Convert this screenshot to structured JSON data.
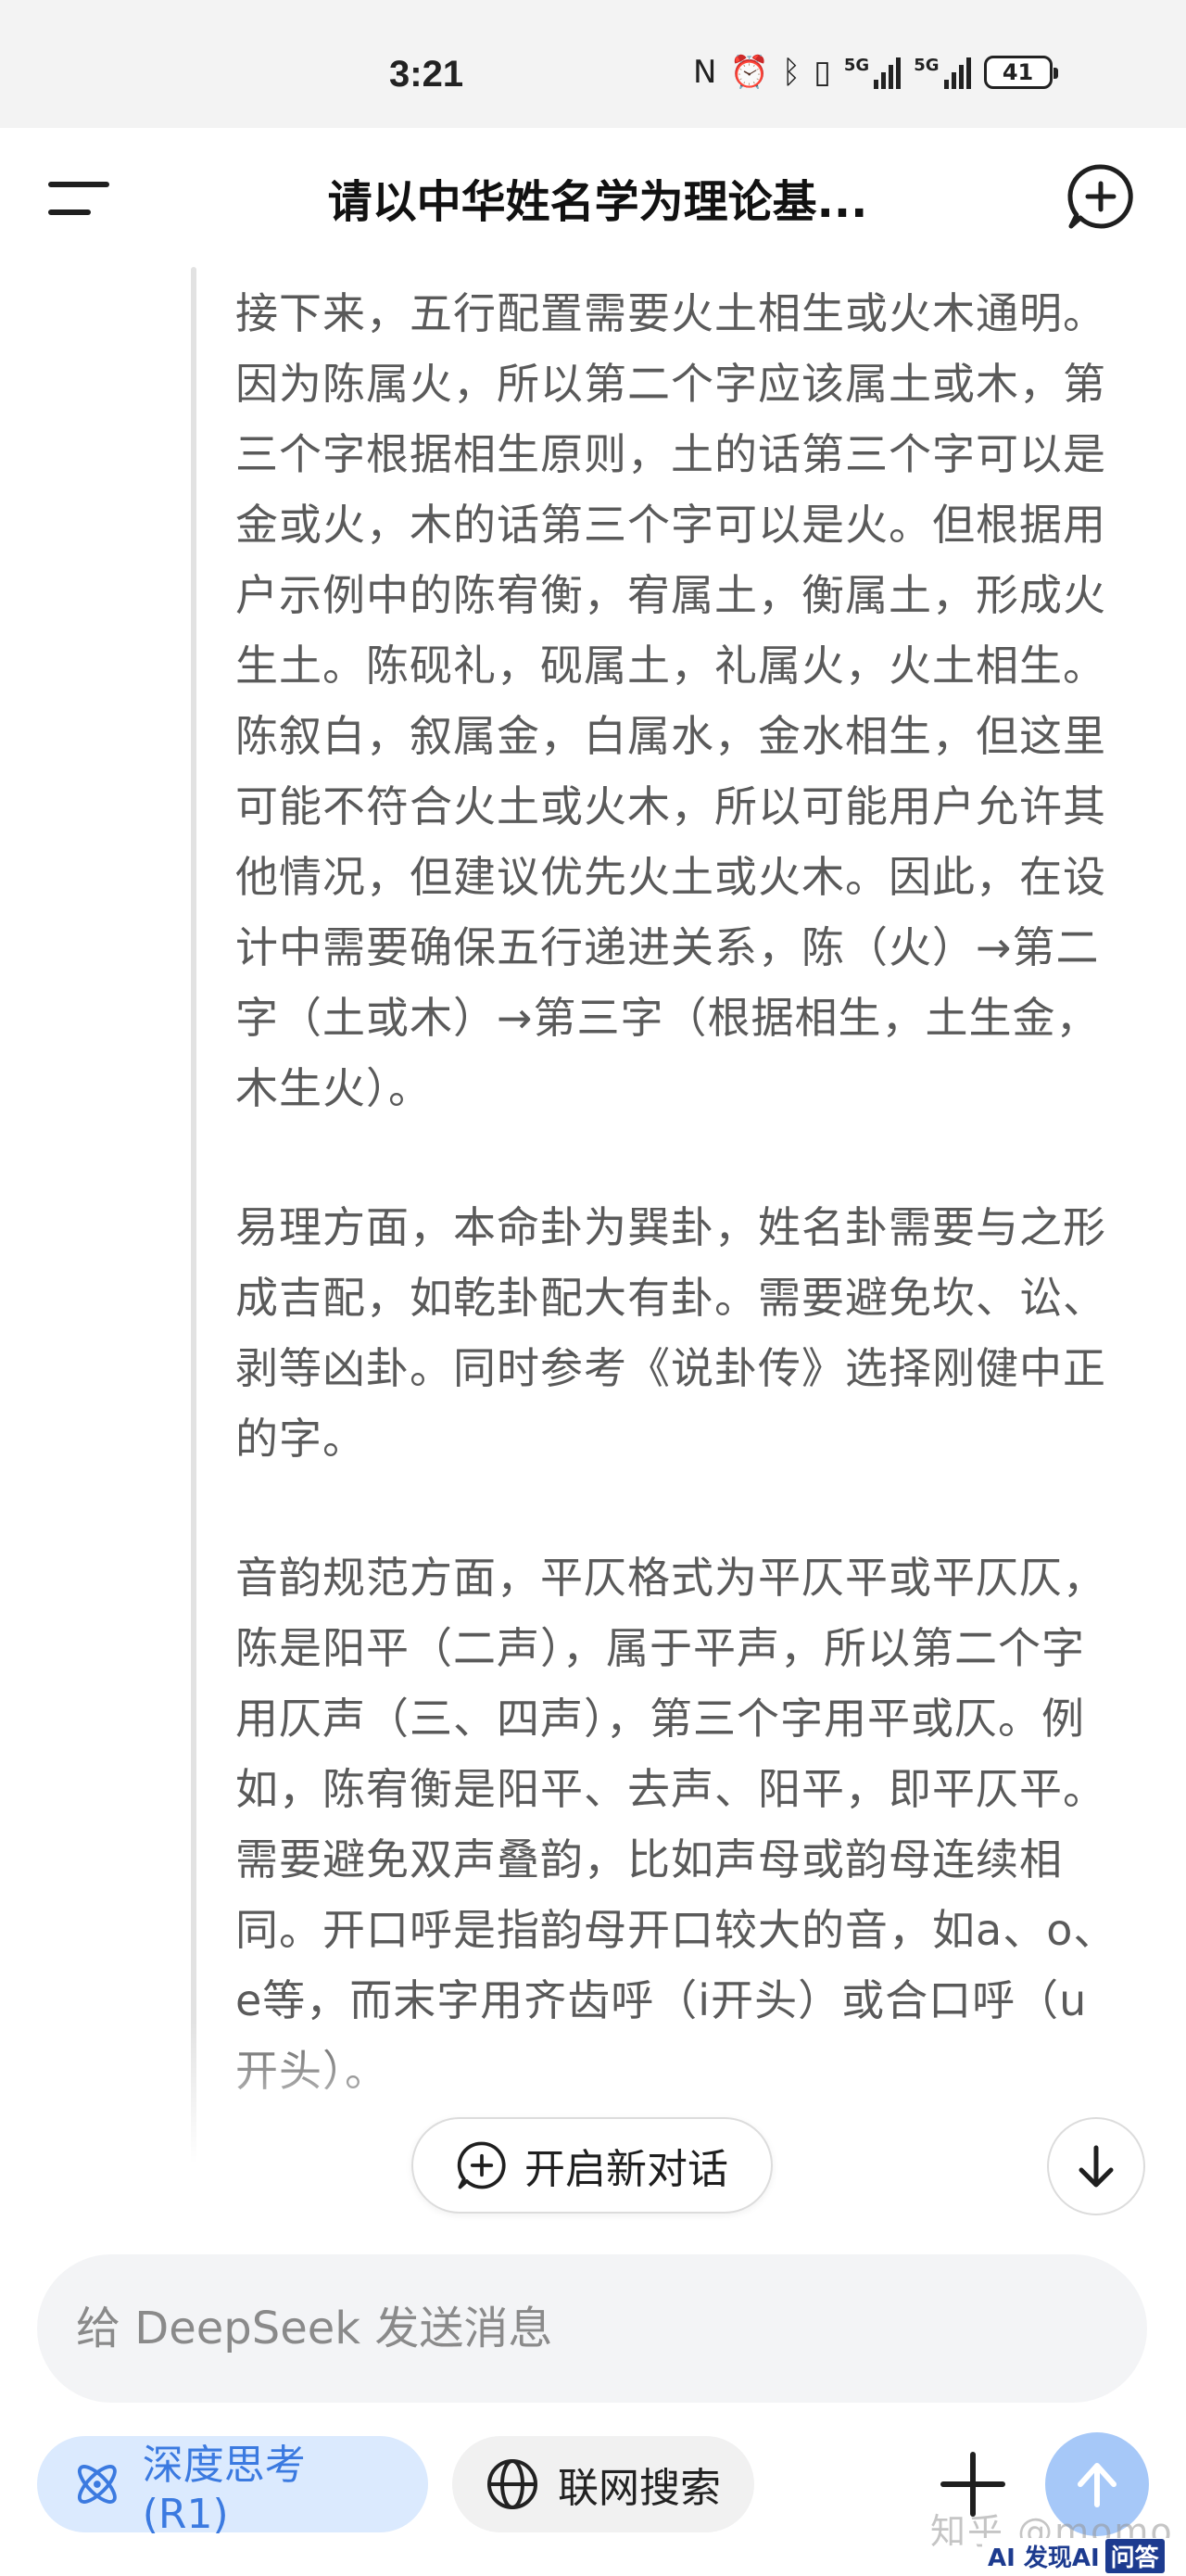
{
  "status_bar": {
    "time": "3:21",
    "battery": "41",
    "signal1": "5G",
    "signal2": "5G"
  },
  "header": {
    "title": "请以中华姓名学为理论基..."
  },
  "thinking": {
    "paragraphs": [
      "接下来，五行配置需要火土相生或火木通明。因为陈属火，所以第二个字应该属土或木，第三个字根据相生原则，土的话第三个字可以是金或火，木的话第三个字可以是火。但根据用户示例中的陈宥衡，宥属土，衡属土，形成火生土。陈砚礼，砚属土，礼属火，火土相生。陈叙白，叙属金，白属水，金水相生，但这里可能不符合火土或火木，所以可能用户允许其他情况，但建议优先火土或火木。因此，在设计中需要确保五行递进关系，陈（火）→第二字（土或木）→第三字（根据相生，土生金，木生火）。",
      "易理方面，本命卦为巽卦，姓名卦需要与之形成吉配，如乾卦配大有卦。需要避免坎、讼、剥等凶卦。同时参考《说卦传》选择刚健中正的字。",
      "音韵规范方面，平仄格式为平仄平或平仄仄，陈是阳平（二声），属于平声，所以第二个字用仄声（三、四声），第三个字用平或仄。例如，陈宥衡是阳平、去声、阳平，即平仄平。需要避免双声叠韵，比如声母或韵母连续相同。开口呼是指韵母开口较大的音，如a、o、e等，而末字用齐齿呼（i开头）或合口呼（u开头）。"
    ]
  },
  "floating": {
    "new_dialog": "开启新对话"
  },
  "composer": {
    "placeholder": "给 DeepSeek 发送消息"
  },
  "tools": {
    "deep_think": "深度思考 (R1)",
    "web_search": "联网搜索"
  },
  "watermark": {
    "text": "知乎 @momo",
    "badge_brand": "AI 发现AI",
    "badge_tag": "问答"
  },
  "colors": {
    "accent": "#3b7ae0",
    "send_disabled": "#a6c8f8",
    "deep_bg": "#dbeafe"
  },
  "icons": [
    "menu-icon",
    "new-chat-icon",
    "arrow-down-icon",
    "atom-icon",
    "globe-icon",
    "plus-icon",
    "arrow-up-icon"
  ]
}
